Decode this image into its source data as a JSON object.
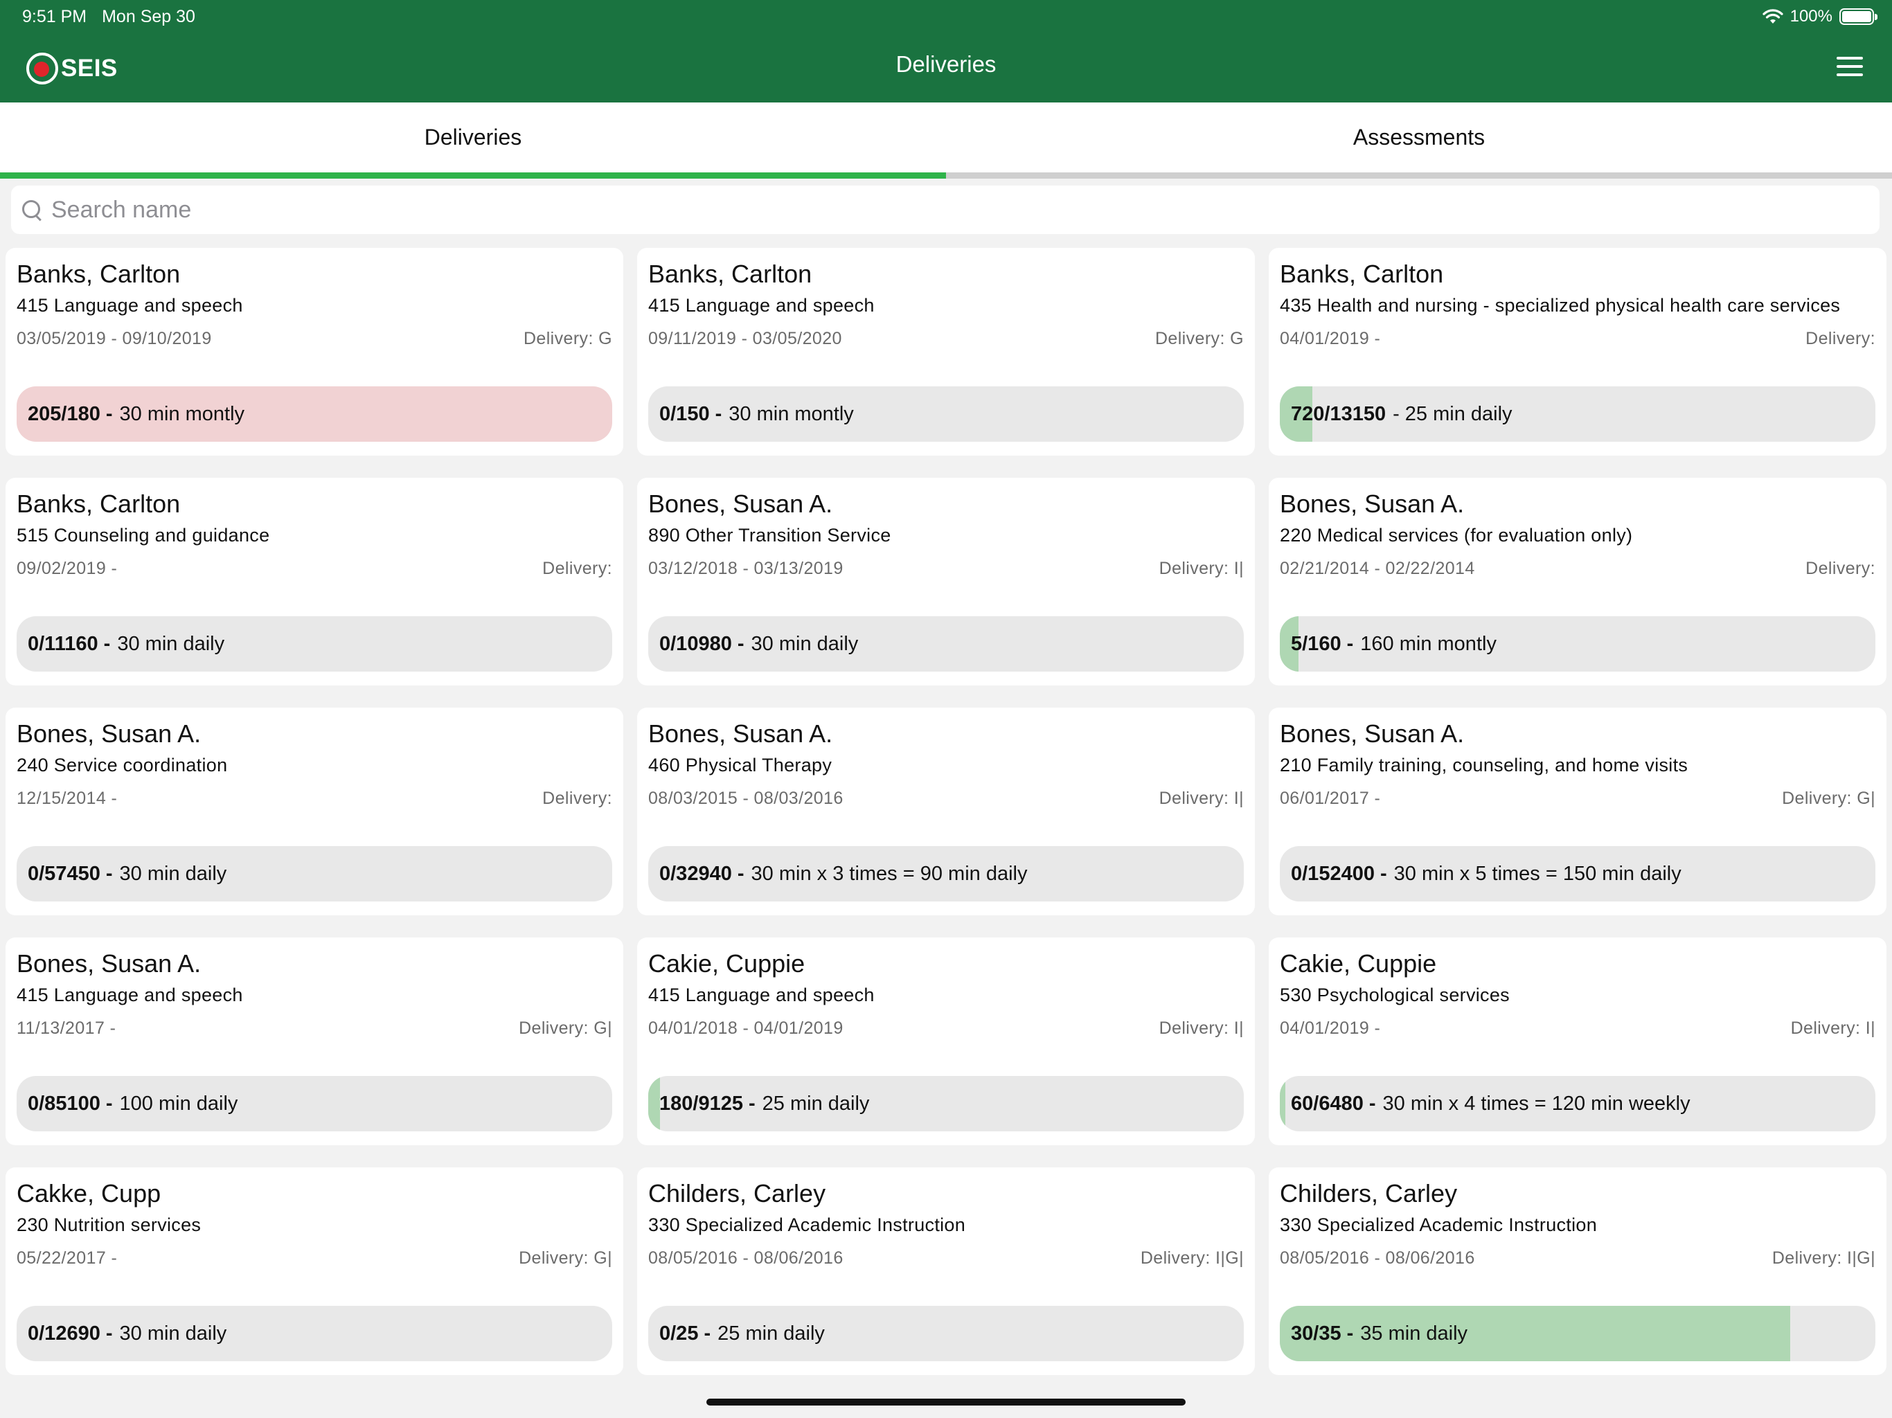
{
  "status_bar": {
    "time": "9:51 PM",
    "date": "Mon Sep 30",
    "battery": "100%"
  },
  "header": {
    "logo_text": "SEIS",
    "title": "Deliveries"
  },
  "tabs": [
    {
      "label": "Deliveries",
      "active": true
    },
    {
      "label": "Assessments",
      "active": false
    }
  ],
  "search": {
    "placeholder": "Search name",
    "value": ""
  },
  "cards": [
    {
      "name": "Banks, Carlton",
      "service": "415 Language and speech",
      "dates": "03/05/2019 - 09/10/2019",
      "delivery": "Delivery: G",
      "count": "205/180 -",
      "frequency": "30 min montly",
      "progress": 1.0,
      "over": true
    },
    {
      "name": "Banks, Carlton",
      "service": "415 Language and speech",
      "dates": "09/11/2019 - 03/05/2020",
      "delivery": "Delivery: G",
      "count": "0/150 -",
      "frequency": "30 min montly",
      "progress": 0.0,
      "over": false
    },
    {
      "name": "Banks, Carlton",
      "service": "435 Health and nursing - specialized physical health care services",
      "dates": "04/01/2019 -",
      "delivery": "Delivery:",
      "count": "720/13150",
      "frequency": "- 25 min daily",
      "progress": 0.055,
      "over": false
    },
    {
      "name": "Banks, Carlton",
      "service": "515 Counseling and guidance",
      "dates": "09/02/2019 -",
      "delivery": "Delivery:",
      "count": "0/11160 -",
      "frequency": "30 min daily",
      "progress": 0.0,
      "over": false
    },
    {
      "name": "Bones, Susan A.",
      "service": "890 Other Transition Service",
      "dates": "03/12/2018 - 03/13/2019",
      "delivery": "Delivery: I|",
      "count": "0/10980 -",
      "frequency": "30 min daily",
      "progress": 0.0,
      "over": false
    },
    {
      "name": "Bones, Susan A.",
      "service": "220 Medical services (for evaluation only)",
      "dates": "02/21/2014 - 02/22/2014",
      "delivery": "Delivery:",
      "count": "5/160 -",
      "frequency": "160 min montly",
      "progress": 0.031,
      "over": false
    },
    {
      "name": "Bones, Susan A.",
      "service": "240 Service coordination",
      "dates": "12/15/2014 -",
      "delivery": "Delivery:",
      "count": "0/57450 -",
      "frequency": "30 min daily",
      "progress": 0.0,
      "over": false
    },
    {
      "name": "Bones, Susan A.",
      "service": "460 Physical Therapy",
      "dates": "08/03/2015 - 08/03/2016",
      "delivery": "Delivery: I|",
      "count": "0/32940 -",
      "frequency": "30 min x 3 times = 90 min daily",
      "progress": 0.0,
      "over": false
    },
    {
      "name": "Bones, Susan A.",
      "service": "210 Family training, counseling, and home visits",
      "dates": "06/01/2017 -",
      "delivery": "Delivery: G|",
      "count": "0/152400 -",
      "frequency": "30 min x 5 times = 150 min daily",
      "progress": 0.0,
      "over": false
    },
    {
      "name": "Bones, Susan A.",
      "service": "415 Language and speech",
      "dates": "11/13/2017 -",
      "delivery": "Delivery: G|",
      "count": "0/85100 -",
      "frequency": "100 min daily",
      "progress": 0.0,
      "over": false
    },
    {
      "name": "Cakie, Cuppie",
      "service": "415 Language and speech",
      "dates": "04/01/2018 - 04/01/2019",
      "delivery": "Delivery: I|",
      "count": "180/9125 -",
      "frequency": "25 min daily",
      "progress": 0.02,
      "over": false
    },
    {
      "name": "Cakie, Cuppie",
      "service": "530 Psychological services",
      "dates": "04/01/2019 -",
      "delivery": "Delivery: I|",
      "count": "60/6480 -",
      "frequency": "30 min x 4 times = 120 min weekly",
      "progress": 0.009,
      "over": false
    },
    {
      "name": "Cakke, Cupp",
      "service": "230 Nutrition services",
      "dates": "05/22/2017 -",
      "delivery": "Delivery: G|",
      "count": "0/12690 -",
      "frequency": "30 min daily",
      "progress": 0.0,
      "over": false
    },
    {
      "name": "Childers, Carley",
      "service": "330 Specialized Academic Instruction",
      "dates": "08/05/2016 - 08/06/2016",
      "delivery": "Delivery: I|G|",
      "count": "0/25 -",
      "frequency": "25 min daily",
      "progress": 0.0,
      "over": false
    },
    {
      "name": "Childers, Carley",
      "service": "330 Specialized Academic Instruction",
      "dates": "08/05/2016 - 08/06/2016",
      "delivery": "Delivery: I|G|",
      "count": "30/35 -",
      "frequency": "35 min daily",
      "progress": 0.857,
      "over": false
    }
  ]
}
